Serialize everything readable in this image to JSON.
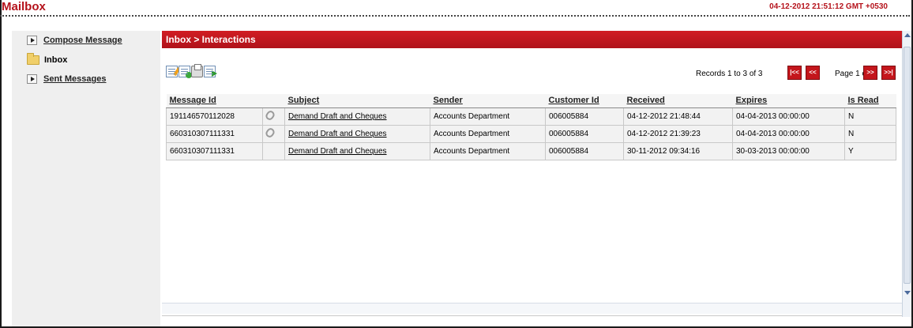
{
  "app": {
    "title": "Mailbox",
    "datetime": "04-12-2012 21:51:12 GMT +0530",
    "accent_color": "#c4161c"
  },
  "sidebar": {
    "items": [
      {
        "label": "Compose Message",
        "icon": "arrow-right-icon"
      },
      {
        "label": "Inbox",
        "icon": "folder-icon"
      },
      {
        "label": "Sent Messages",
        "icon": "arrow-right-icon"
      }
    ]
  },
  "main": {
    "breadcrumb": "Inbox > Interactions",
    "toolbar": {
      "icons": [
        "edit-icon",
        "new-message-icon",
        "print-icon",
        "forward-icon"
      ]
    },
    "pager": {
      "records_text": "Records 1 to 3 of 3",
      "page_text": "Page 1 of 1",
      "first": "|<<",
      "prev": "<<",
      "next": ">>",
      "last": ">>|"
    },
    "table": {
      "columns": [
        "Message Id",
        "",
        "Subject",
        "Sender",
        "Customer Id",
        "Received",
        "Expires",
        "Is Read"
      ],
      "rows": [
        {
          "message_id": "191146570112028",
          "attachment": "paperclip-icon",
          "subject": "Demand Draft and Cheques",
          "sender": "Accounts Department",
          "customer_id": "006005884",
          "received": "04-12-2012 21:48:44",
          "expires": "04-04-2013 00:00:00",
          "is_read": "N"
        },
        {
          "message_id": "660310307111331",
          "attachment": "paperclip-icon",
          "subject": "Demand Draft and Cheques",
          "sender": "Accounts Department",
          "customer_id": "006005884",
          "received": "04-12-2012 21:39:23",
          "expires": "04-04-2013 00:00:00",
          "is_read": "N"
        },
        {
          "message_id": "660310307111331",
          "attachment": "",
          "subject": "Demand Draft and Cheques",
          "sender": "Accounts Department",
          "customer_id": "006005884",
          "received": "30-11-2012 09:34:16",
          "expires": "30-03-2013 00:00:00",
          "is_read": "Y"
        }
      ]
    }
  }
}
